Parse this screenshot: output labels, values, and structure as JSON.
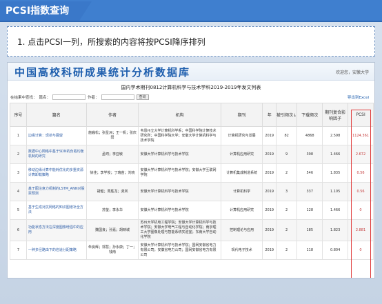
{
  "slide": {
    "title": "PCSI指数查询",
    "note": "1. 点击PCSI一列，所搜索的内容将按PCSI降序排列"
  },
  "site": {
    "title": "中国高校科研成果统计分析数据库",
    "welcome": "欢迎您，安徽大学"
  },
  "report": {
    "title": "国内学术期刊0812计算机科学与技术学科2019-2019年发文列表"
  },
  "search": {
    "scope_label": "在结果中查找：",
    "title_label": "篇名：",
    "author_label": "作者：",
    "button": "查询",
    "export": "导出到Excel"
  },
  "table": {
    "headers": [
      "序号",
      "篇名",
      "作者",
      "机构",
      "期刊",
      "年",
      "被引频次↓",
      "下载频次",
      "期刊复合影响因子",
      "PCSI"
    ],
    "rows": [
      {
        "no": "1",
        "title": "边缘计算：现状与展望",
        "authors": "施巍松；张星洲；王一帆；张庆阳",
        "inst": "韦恩州立大学计算机科学系；中国科学院计算技术研究所；中国科学院大学；安徽大学计算机科学与技术学院",
        "journal": "计算机研究与发展",
        "year": "2019",
        "cited": "82",
        "dl": "4868",
        "impact": "2.598",
        "pcsi": "1124.361"
      },
      {
        "no": "2",
        "title": "数据中心网络中基于SDN的负载均衡机制的研究",
        "authors": "孟珂；李亚敏",
        "inst": "安徽大学计算机科学与技术学院",
        "journal": "计算机应用研究",
        "year": "2019",
        "cited": "9",
        "dl": "398",
        "impact": "1.466",
        "pcsi": "2.672"
      },
      {
        "no": "3",
        "title": "移动边缘计算中能耗优化的多重资源计算卸载策略",
        "authors": "徐佳；李学俊；丁瑞苗；刘晓",
        "inst": "安徽大学计算机科学与技术学院；安徽大学互联网学院",
        "journal": "计算机集成制造系统",
        "year": "2019",
        "cited": "2",
        "dl": "546",
        "impact": "1.835",
        "pcsi": "0.56"
      },
      {
        "no": "4",
        "title": "基于图注意力机制的LSTM_ANN对股票预测",
        "authors": "胡健；周胜龙；龚凤",
        "inst": "安徽大学计算机科学与技术学院",
        "journal": "计算机科学",
        "year": "2019",
        "cited": "3",
        "dl": "337",
        "impact": "1.105",
        "pcsi": "0.56"
      },
      {
        "no": "5",
        "title": "基于生成对抗网络的知识图谱补全方法",
        "authors": "苏莹；李永华",
        "inst": "安徽大学计算机科学与技术学院",
        "journal": "计算机应用研究",
        "year": "2019",
        "cited": "2",
        "dl": "128",
        "impact": "1.466",
        "pcsi": "0"
      },
      {
        "no": "6",
        "title": "功能状态方法在深度图像增强中的应用",
        "authors": "魏国良；孙嘉；胡映城",
        "inst": "苏州大学机电工程学院；安徽大学计算机科学与技术学院；安徽大学电气工程与自动化学院；南京理工大学图像处理与智能系统实验室；东南大学自动化学院",
        "journal": "控制理论与应用",
        "year": "2019",
        "cited": "2",
        "dl": "185",
        "impact": "1.823",
        "pcsi": "2.881"
      },
      {
        "no": "7",
        "title": "一种多径路由下的信道分配策略",
        "authors": "朱良辉；郭慧；孙永康；丁一；钱南",
        "inst": "安徽大学计算机科学与技术学院；国网安徽省电力有限公司；安徽省电力公司；国网安徽省电力有限公司",
        "journal": "现代电子技术",
        "year": "2019",
        "cited": "2",
        "dl": "118",
        "impact": "0.804",
        "pcsi": "0"
      }
    ]
  },
  "colors": {
    "title_bar": "#3a78c9",
    "highlight": "#e03a3a",
    "link": "#2e5ea8"
  }
}
